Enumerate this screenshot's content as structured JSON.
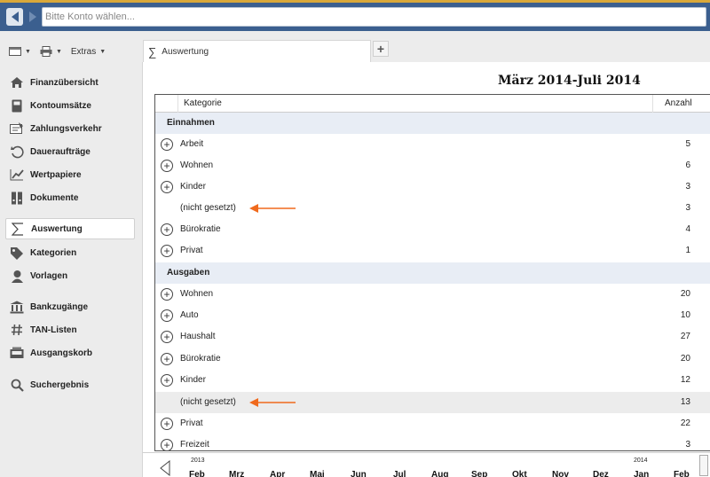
{
  "topbar": {
    "account_placeholder": "Bitte Konto wählen..."
  },
  "toolbar": {
    "extras_label": "Extras"
  },
  "sidebar": {
    "items": [
      {
        "label": "Finanzübersicht",
        "icon": "home-icon"
      },
      {
        "label": "Kontoumsätze",
        "icon": "ledger-icon"
      },
      {
        "label": "Zahlungsverkehr",
        "icon": "transfer-icon"
      },
      {
        "label": "Daueraufträge",
        "icon": "recurring-icon"
      },
      {
        "label": "Wertpapiere",
        "icon": "chart-line-icon"
      },
      {
        "label": "Dokumente",
        "icon": "documents-icon"
      },
      {
        "label": "Auswertung",
        "icon": "sigma-icon"
      },
      {
        "label": "Kategorien",
        "icon": "tag-icon"
      },
      {
        "label": "Vorlagen",
        "icon": "template-icon"
      },
      {
        "label": "Bankzugänge",
        "icon": "bank-icon"
      },
      {
        "label": "TAN-Listen",
        "icon": "hash-icon"
      },
      {
        "label": "Ausgangskorb",
        "icon": "outbox-icon"
      },
      {
        "label": "Suchergebnis",
        "icon": "search-icon"
      }
    ],
    "active_item": "Auswertung"
  },
  "tabs": {
    "active_tab_label": "Auswertung",
    "add_tab": "+"
  },
  "report": {
    "title": "März 2014-Juli 2014",
    "columns": {
      "kategorie": "Kategorie",
      "anzahl": "Anzahl"
    },
    "groups": [
      {
        "name": "Einnahmen",
        "rows": [
          {
            "label": "Arbeit",
            "count": "5",
            "expandable": true
          },
          {
            "label": "Wohnen",
            "count": "6",
            "expandable": true
          },
          {
            "label": "Kinder",
            "count": "3",
            "expandable": true
          },
          {
            "label": "(nicht gesetzt)",
            "count": "3",
            "expandable": false,
            "arrow": true
          },
          {
            "label": "Bürokratie",
            "count": "4",
            "expandable": true
          },
          {
            "label": "Privat",
            "count": "1",
            "expandable": true
          }
        ]
      },
      {
        "name": "Ausgaben",
        "rows": [
          {
            "label": "Wohnen",
            "count": "20",
            "expandable": true
          },
          {
            "label": "Auto",
            "count": "10",
            "expandable": true
          },
          {
            "label": "Haushalt",
            "count": "27",
            "expandable": true
          },
          {
            "label": "Bürokratie",
            "count": "20",
            "expandable": true
          },
          {
            "label": "Kinder",
            "count": "12",
            "expandable": true
          },
          {
            "label": "(nicht gesetzt)",
            "count": "13",
            "expandable": false,
            "arrow": true,
            "highlight": true
          },
          {
            "label": "Privat",
            "count": "22",
            "expandable": true
          },
          {
            "label": "Freizeit",
            "count": "3",
            "expandable": true
          }
        ]
      }
    ],
    "arrow_color": "#f06a1d"
  },
  "timeline": {
    "year_start": "2013",
    "year_end": "2014",
    "months": [
      "Feb",
      "Mrz",
      "Apr",
      "Mai",
      "Jun",
      "Jul",
      "Aug",
      "Sep",
      "Okt",
      "Nov",
      "Dez",
      "Jan",
      "Feb"
    ]
  },
  "colors": {
    "topbar": "#3b5f8f",
    "topbar_accent": "#d9a83a",
    "group_row": "#e8edf5",
    "arrow": "#f06a1d"
  }
}
